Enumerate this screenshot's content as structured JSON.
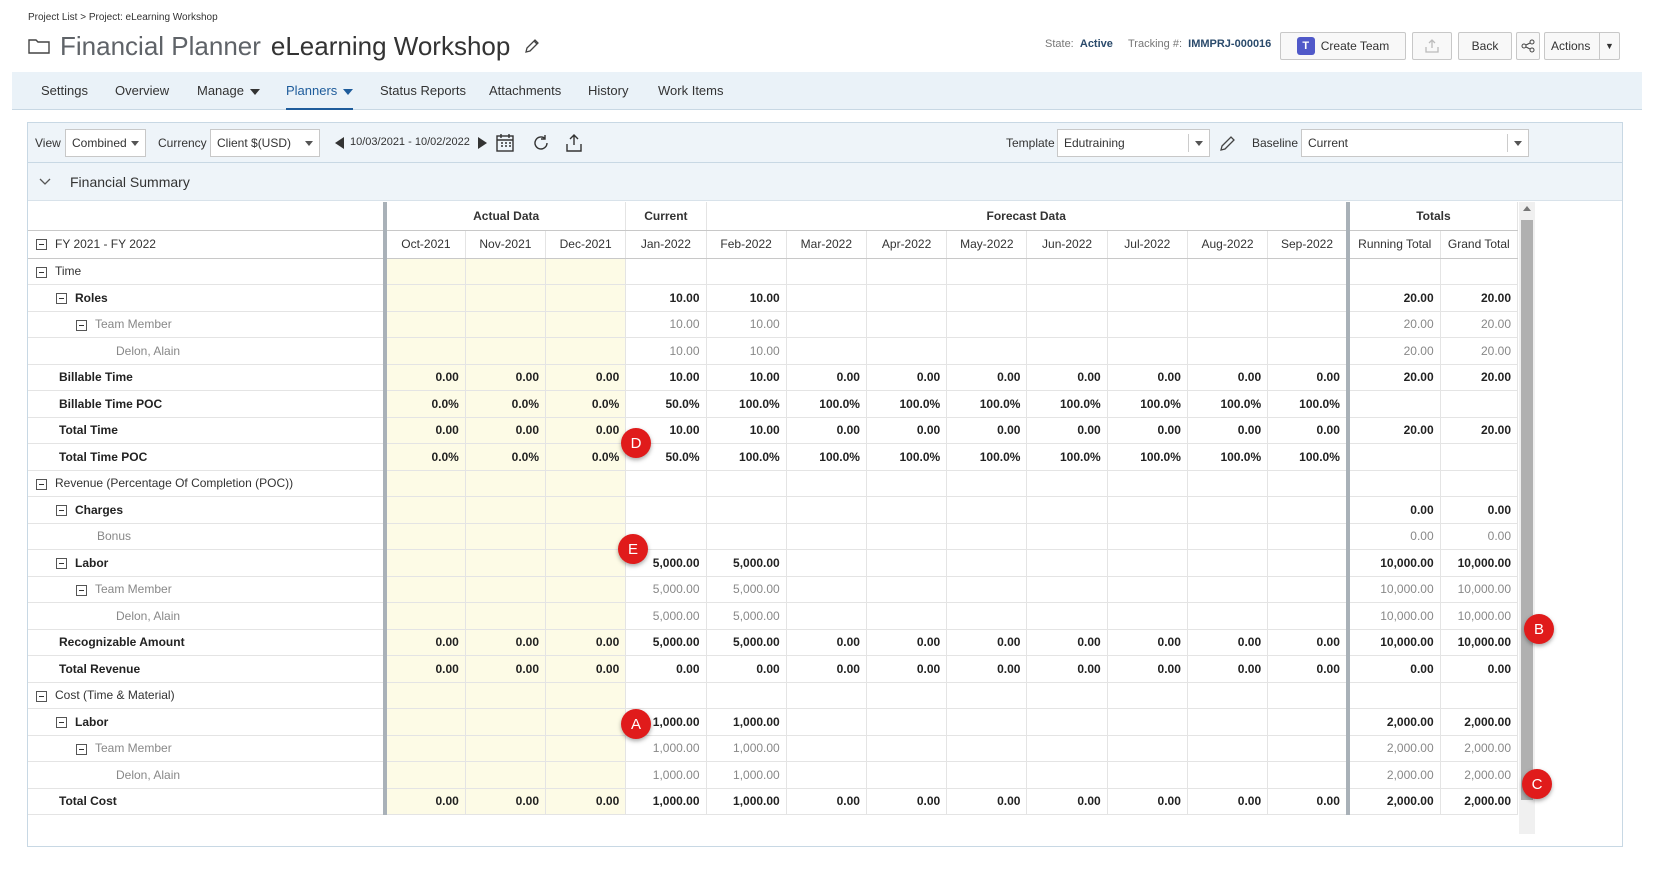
{
  "breadcrumb": "Project List > Project: eLearning Workshop",
  "title": {
    "app": "Financial Planner",
    "project": "eLearning Workshop"
  },
  "header": {
    "state_label": "State:",
    "state_value": "Active",
    "tracking_label": "Tracking #:",
    "tracking_value": "IMMPRJ-000016",
    "create_team": "Create Team",
    "back": "Back",
    "actions": "Actions"
  },
  "nav": [
    "Settings",
    "Overview",
    "Manage",
    "Planners",
    "Status Reports",
    "Attachments",
    "History",
    "Work Items"
  ],
  "toolbar": {
    "view_label": "View",
    "view_value": "Combined",
    "currency_label": "Currency",
    "currency_value": "Client $(USD)",
    "date_range": "10/03/2021 - 10/02/2022",
    "template_label": "Template",
    "template_value": "Edutraining",
    "baseline_label": "Baseline",
    "baseline_value": "Current"
  },
  "section_title": "Financial Summary",
  "groups": {
    "actual": "Actual Data",
    "current": "Current",
    "forecast": "Forecast Data",
    "totals": "Totals"
  },
  "period_label": "FY 2021 - FY 2022",
  "columns": [
    "Oct-2021",
    "Nov-2021",
    "Dec-2021",
    "Jan-2022",
    "Feb-2022",
    "Mar-2022",
    "Apr-2022",
    "May-2022",
    "Jun-2022",
    "Jul-2022",
    "Aug-2022",
    "Sep-2022",
    "Running Total",
    "Grand Total"
  ],
  "rows": [
    {
      "label": "Time",
      "level": 0,
      "toggle": true,
      "style": "norm",
      "values": [
        "",
        "",
        "",
        "",
        "",
        "",
        "",
        "",
        "",
        "",
        "",
        "",
        "",
        ""
      ]
    },
    {
      "label": "Roles",
      "level": 1,
      "toggle": true,
      "style": "bold",
      "values": [
        "",
        "",
        "",
        "10.00",
        "10.00",
        "",
        "",
        "",
        "",
        "",
        "",
        "",
        "20.00",
        "20.00"
      ]
    },
    {
      "label": "Team Member",
      "level": 2,
      "toggle": true,
      "style": "light",
      "values": [
        "",
        "",
        "",
        "10.00",
        "10.00",
        "",
        "",
        "",
        "",
        "",
        "",
        "",
        "20.00",
        "20.00"
      ]
    },
    {
      "label": "Delon, Alain",
      "level": 3,
      "toggle": false,
      "style": "light",
      "values": [
        "",
        "",
        "",
        "10.00",
        "10.00",
        "",
        "",
        "",
        "",
        "",
        "",
        "",
        "20.00",
        "20.00"
      ]
    },
    {
      "label": "Billable Time",
      "level": 0,
      "toggle": false,
      "style": "bold",
      "values": [
        "0.00",
        "0.00",
        "0.00",
        "10.00",
        "10.00",
        "0.00",
        "0.00",
        "0.00",
        "0.00",
        "0.00",
        "0.00",
        "0.00",
        "20.00",
        "20.00"
      ]
    },
    {
      "label": "Billable Time POC",
      "level": 0,
      "toggle": false,
      "style": "bold",
      "values": [
        "0.0%",
        "0.0%",
        "0.0%",
        "50.0%",
        "100.0%",
        "100.0%",
        "100.0%",
        "100.0%",
        "100.0%",
        "100.0%",
        "100.0%",
        "100.0%",
        "",
        ""
      ]
    },
    {
      "label": "Total Time",
      "level": 0,
      "toggle": false,
      "style": "bold",
      "values": [
        "0.00",
        "0.00",
        "0.00",
        "10.00",
        "10.00",
        "0.00",
        "0.00",
        "0.00",
        "0.00",
        "0.00",
        "0.00",
        "0.00",
        "20.00",
        "20.00"
      ]
    },
    {
      "label": "Total Time POC",
      "level": 0,
      "toggle": false,
      "style": "bold",
      "values": [
        "0.0%",
        "0.0%",
        "0.0%",
        "50.0%",
        "100.0%",
        "100.0%",
        "100.0%",
        "100.0%",
        "100.0%",
        "100.0%",
        "100.0%",
        "100.0%",
        "",
        ""
      ]
    },
    {
      "label": "Revenue (Percentage Of Completion (POC))",
      "level": 0,
      "toggle": true,
      "style": "norm",
      "values": [
        "",
        "",
        "",
        "",
        "",
        "",
        "",
        "",
        "",
        "",
        "",
        "",
        "",
        ""
      ]
    },
    {
      "label": "Charges",
      "level": 1,
      "toggle": true,
      "style": "bold",
      "values": [
        "",
        "",
        "",
        "",
        "",
        "",
        "",
        "",
        "",
        "",
        "",
        "",
        "0.00",
        "0.00"
      ]
    },
    {
      "label": "Bonus",
      "level": 2,
      "toggle": false,
      "style": "light",
      "values": [
        "",
        "",
        "",
        "",
        "",
        "",
        "",
        "",
        "",
        "",
        "",
        "",
        "0.00",
        "0.00"
      ]
    },
    {
      "label": "Labor",
      "level": 1,
      "toggle": true,
      "style": "bold",
      "values": [
        "",
        "",
        "",
        "5,000.00",
        "5,000.00",
        "",
        "",
        "",
        "",
        "",
        "",
        "",
        "10,000.00",
        "10,000.00"
      ]
    },
    {
      "label": "Team Member",
      "level": 2,
      "toggle": true,
      "style": "light",
      "values": [
        "",
        "",
        "",
        "5,000.00",
        "5,000.00",
        "",
        "",
        "",
        "",
        "",
        "",
        "",
        "10,000.00",
        "10,000.00"
      ]
    },
    {
      "label": "Delon, Alain",
      "level": 3,
      "toggle": false,
      "style": "light",
      "values": [
        "",
        "",
        "",
        "5,000.00",
        "5,000.00",
        "",
        "",
        "",
        "",
        "",
        "",
        "",
        "10,000.00",
        "10,000.00"
      ]
    },
    {
      "label": "Recognizable Amount",
      "level": 0,
      "toggle": false,
      "style": "bold",
      "values": [
        "0.00",
        "0.00",
        "0.00",
        "5,000.00",
        "5,000.00",
        "0.00",
        "0.00",
        "0.00",
        "0.00",
        "0.00",
        "0.00",
        "0.00",
        "10,000.00",
        "10,000.00"
      ]
    },
    {
      "label": "Total Revenue",
      "level": 0,
      "toggle": false,
      "style": "bold",
      "values": [
        "0.00",
        "0.00",
        "0.00",
        "0.00",
        "0.00",
        "0.00",
        "0.00",
        "0.00",
        "0.00",
        "0.00",
        "0.00",
        "0.00",
        "0.00",
        "0.00"
      ]
    },
    {
      "label": "Cost (Time & Material)",
      "level": 0,
      "toggle": true,
      "style": "norm",
      "values": [
        "",
        "",
        "",
        "",
        "",
        "",
        "",
        "",
        "",
        "",
        "",
        "",
        "",
        ""
      ]
    },
    {
      "label": "Labor",
      "level": 1,
      "toggle": true,
      "style": "bold",
      "values": [
        "",
        "",
        "",
        "1,000.00",
        "1,000.00",
        "",
        "",
        "",
        "",
        "",
        "",
        "",
        "2,000.00",
        "2,000.00"
      ]
    },
    {
      "label": "Team Member",
      "level": 2,
      "toggle": true,
      "style": "light",
      "values": [
        "",
        "",
        "",
        "1,000.00",
        "1,000.00",
        "",
        "",
        "",
        "",
        "",
        "",
        "",
        "2,000.00",
        "2,000.00"
      ]
    },
    {
      "label": "Delon, Alain",
      "level": 3,
      "toggle": false,
      "style": "light",
      "values": [
        "",
        "",
        "",
        "1,000.00",
        "1,000.00",
        "",
        "",
        "",
        "",
        "",
        "",
        "",
        "2,000.00",
        "2,000.00"
      ]
    },
    {
      "label": "Total Cost",
      "level": 0,
      "toggle": false,
      "style": "bold",
      "values": [
        "0.00",
        "0.00",
        "0.00",
        "1,000.00",
        "1,000.00",
        "0.00",
        "0.00",
        "0.00",
        "0.00",
        "0.00",
        "0.00",
        "0.00",
        "2,000.00",
        "2,000.00"
      ]
    }
  ],
  "markers": [
    "A",
    "B",
    "C",
    "D",
    "E"
  ]
}
